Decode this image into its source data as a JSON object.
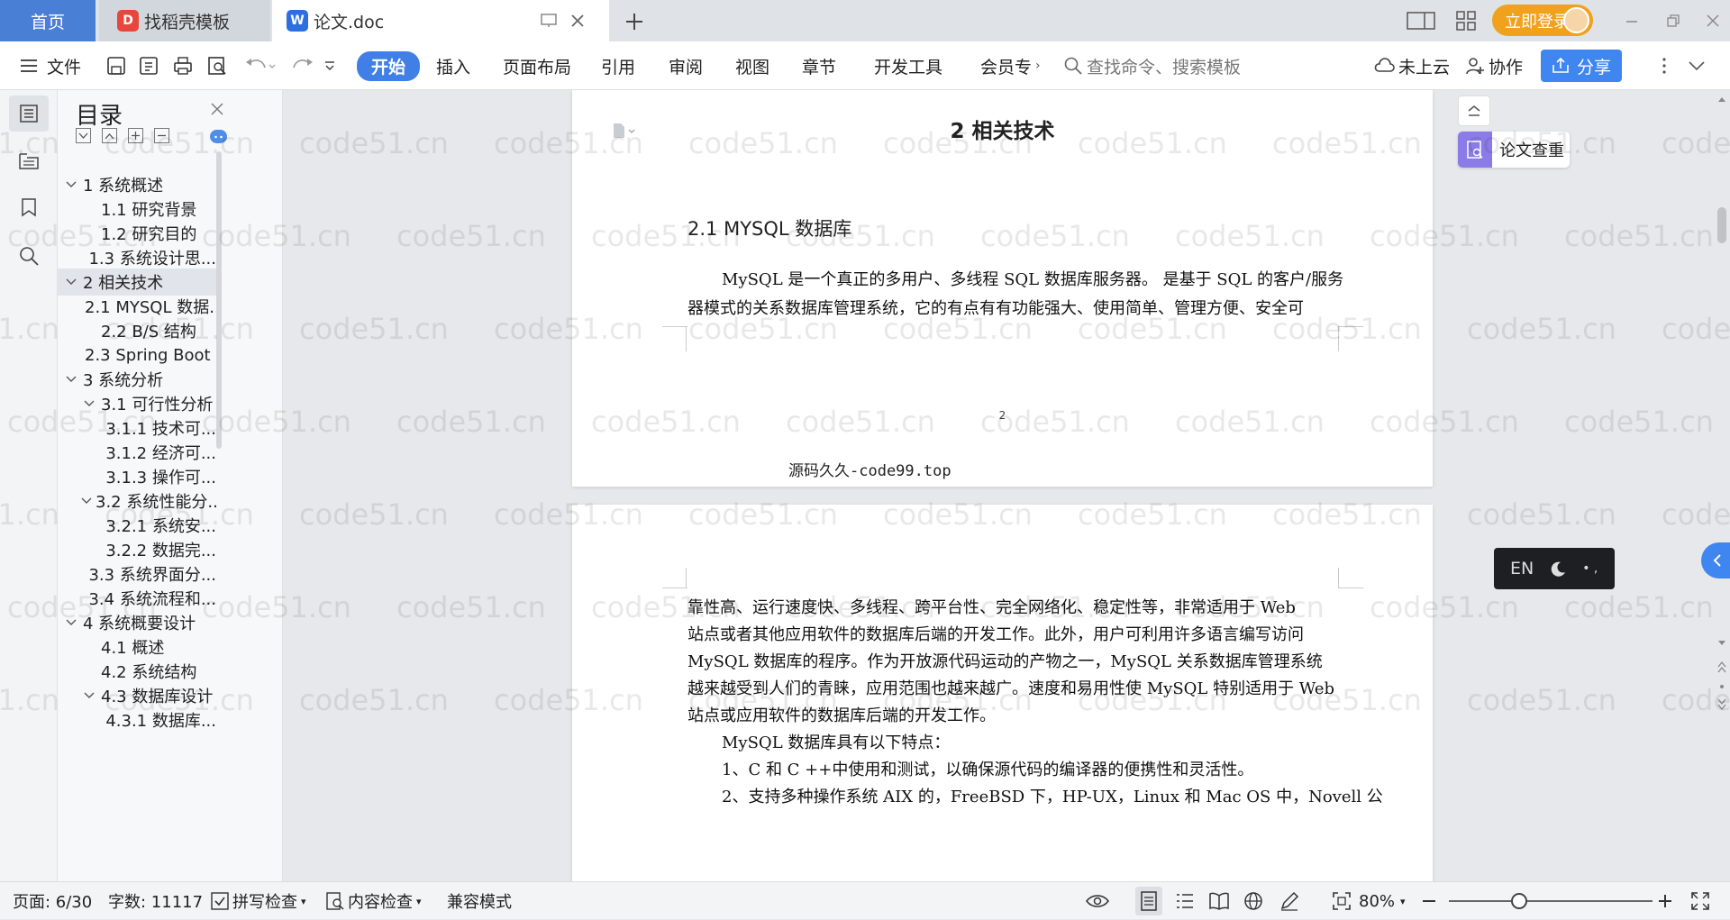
{
  "tabs": {
    "home": "首页",
    "template": "找稻壳模板",
    "doc": "论文.doc"
  },
  "titlebar": {
    "login": "立即登录"
  },
  "toolbar": {
    "file": "文件",
    "ribbon": [
      "开始",
      "插入",
      "页面布局",
      "引用",
      "审阅",
      "视图",
      "章节",
      "开发工具",
      "会员专"
    ],
    "search_placeholder": "查找命令、搜索模板",
    "cloud": "未上云",
    "collab": "协作",
    "share": "分享"
  },
  "outline": {
    "title": "目录",
    "items": [
      {
        "label": "1 系统概述",
        "level": 1,
        "caret": true
      },
      {
        "label": "1.1  研究背景",
        "level": 2,
        "caret": false
      },
      {
        "label": "1.2 研究目的",
        "level": 2,
        "caret": false
      },
      {
        "label": "1.3 系统设计思...",
        "level": 2,
        "caret": false
      },
      {
        "label": "2 相关技术",
        "level": 1,
        "caret": true,
        "selected": true
      },
      {
        "label": "2.1 MYSQL 数据...",
        "level": 2,
        "caret": false
      },
      {
        "label": "2.2 B/S 结构",
        "level": 2,
        "caret": false
      },
      {
        "label": "2.3 Spring Boot ...",
        "level": 2,
        "caret": false
      },
      {
        "label": "3 系统分析",
        "level": 1,
        "caret": true
      },
      {
        "label": "3.1 可行性分析",
        "level": 2,
        "caret": true
      },
      {
        "label": "3.1.1 技术可...",
        "level": 3,
        "caret": false
      },
      {
        "label": "3.1.2 经济可...",
        "level": 3,
        "caret": false
      },
      {
        "label": "3.1.3 操作可...",
        "level": 3,
        "caret": false
      },
      {
        "label": "3.2 系统性能分...",
        "level": 2,
        "caret": true
      },
      {
        "label": "3.2.1  系统安...",
        "level": 3,
        "caret": false
      },
      {
        "label": "3.2.2  数据完...",
        "level": 3,
        "caret": false
      },
      {
        "label": "3.3 系统界面分...",
        "level": 2,
        "caret": false
      },
      {
        "label": "3.4 系统流程和...",
        "level": 2,
        "caret": false
      },
      {
        "label": "4 系统概要设计",
        "level": 1,
        "caret": true
      },
      {
        "label": "4.1 概述",
        "level": 2,
        "caret": false
      },
      {
        "label": "4.2 系统结构",
        "level": 2,
        "caret": false
      },
      {
        "label": "4.3 数据库设计",
        "level": 2,
        "caret": true
      },
      {
        "label": "4.3.1 数据库...",
        "level": 3,
        "caret": false
      }
    ]
  },
  "document": {
    "page1": {
      "heading": "2 相关技术",
      "subheading": "2.1 MYSQL 数据库",
      "lines": [
        "MySQL 是一个真正的多用户、多线程 SQL 数据库服务器。 是基于 SQL 的客户/服务",
        "器模式的关系数据库管理系统，它的有点有有功能强大、使用简单、管理方便、安全可"
      ],
      "page_number": "2",
      "footer": "源码久久-code99.top"
    },
    "page2": {
      "lines": [
        "靠性高、运行速度快、多线程、跨平台性、完全网络化、稳定性等，非常适用于 Web",
        "站点或者其他应用软件的数据库后端的开发工作。此外，用户可利用许多语言编写访问",
        "MySQL 数据库的程序。作为开放源代码运动的产物之一，MySQL 关系数据库管理系统",
        "越来越受到人们的青睐，应用范围也越来越广。速度和易用性使 MySQL 特别适用于 Web",
        "站点或应用软件的数据库后端的开发工作。",
        "MySQL 数据库具有以下特点：",
        "1、C 和 C ++中使用和测试，以确保源代码的编译器的便携性和灵活性。",
        "2、支持多种操作系统 AIX 的，FreeBSD 下，HP-UX，Linux 和 Mac OS 中，Novell 公"
      ]
    },
    "watermark": "code51.cn"
  },
  "float": {
    "check_label": "论文查重",
    "ime_lang": "EN"
  },
  "status": {
    "page": "页面: 6/30",
    "words": "字数: 11117",
    "spell": "拼写检查",
    "content": "内容检查",
    "compat": "兼容模式",
    "zoom": "80%"
  },
  "colors": {
    "accent": "#3f7fe6",
    "login": "#f0a21d",
    "home_tab": "#4a7fd6",
    "share": "#3f86f0",
    "check_badge": "#8b7be8"
  }
}
